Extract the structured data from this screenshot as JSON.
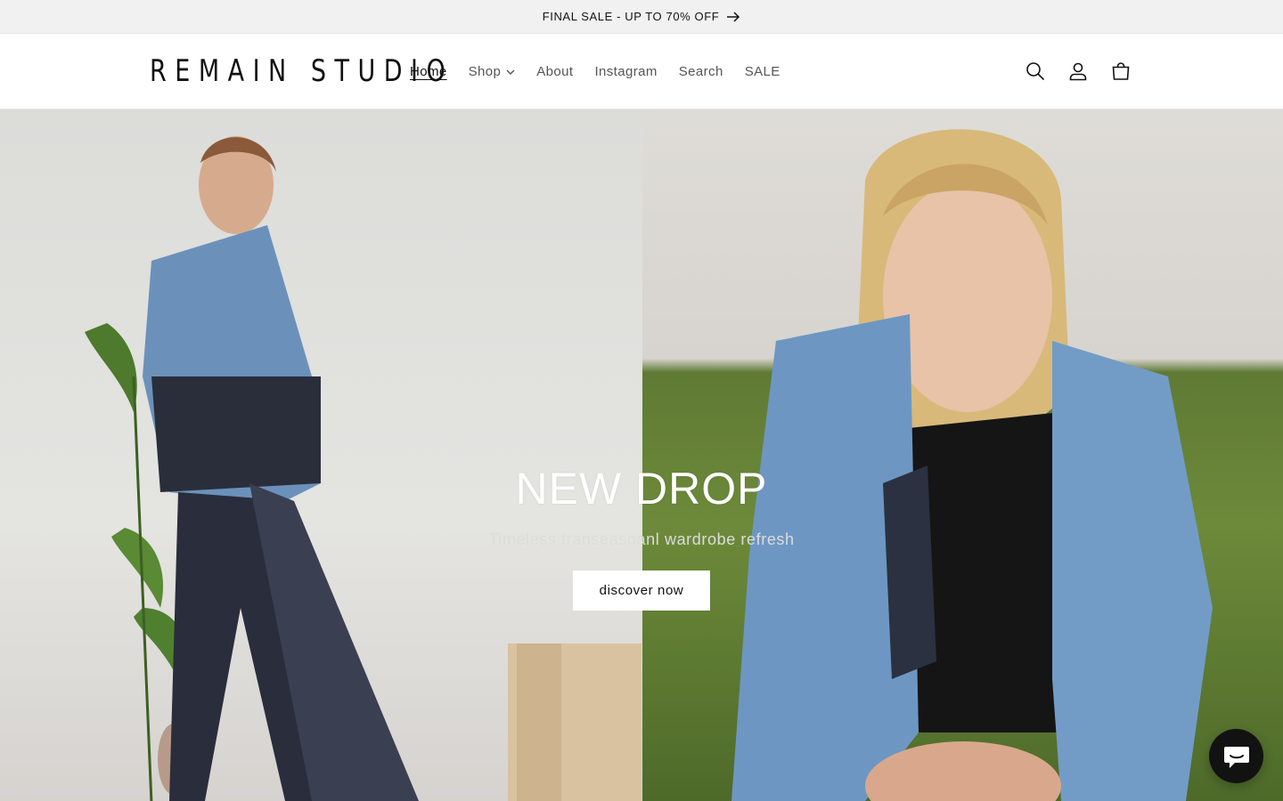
{
  "announcement": {
    "text": "FINAL SALE - UP TO 70% OFF",
    "icon": "arrow-right-icon"
  },
  "header": {
    "logo": "REMAIN STUDIO",
    "nav": [
      {
        "label": "Home",
        "active": true
      },
      {
        "label": "Shop",
        "has_dropdown": true
      },
      {
        "label": "About"
      },
      {
        "label": "Instagram"
      },
      {
        "label": "Search"
      },
      {
        "label": "SALE"
      }
    ],
    "icons": [
      "search-icon",
      "account-icon",
      "cart-icon"
    ]
  },
  "hero": {
    "title": "NEW DROP",
    "subtitle": "Timeless transeasoanl wardrobe refresh",
    "button_label": "discover now"
  },
  "chat": {
    "icon": "chat-icon"
  },
  "colors": {
    "accent": "#121212",
    "announcement_bg": "#f1f1f1",
    "hero_text": "#ffffff"
  }
}
